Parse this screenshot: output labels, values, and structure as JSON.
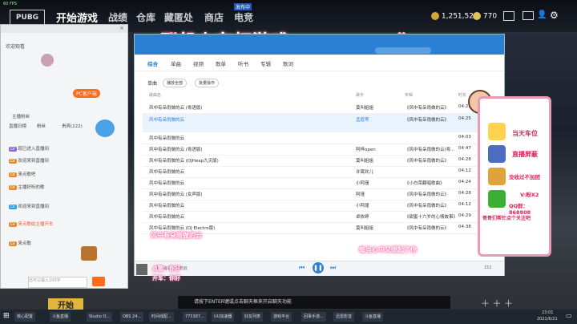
{
  "hud": {
    "fps": "60 FPS"
  },
  "game": {
    "logo": "PUBG",
    "tabs": [
      "开始游戏",
      "战绩",
      "仓库",
      "藏匿处",
      "商店",
      "电竞"
    ],
    "badge_live": "发布中",
    "currency": {
      "bp": "1,251,520",
      "g": "770"
    },
    "bottom_btn": "开始"
  },
  "left_panel": {
    "title": "欢迎观看",
    "pc_client_label": "PC客户端",
    "tabs": [
      "主播粉丝",
      "直播日榜",
      "粉丝",
      "贵宾(222)"
    ],
    "chat": [
      {
        "user": "贵宾",
        "text": "现已进入直播间"
      },
      {
        "user": "观众",
        "text": "欢迎来到直播间"
      },
      {
        "user": "观众",
        "text": "来点歌吧"
      },
      {
        "user": "观众",
        "text": "主播好听的歌"
      },
      {
        "user": "观众",
        "text": "欢迎来到直播间"
      },
      {
        "user": "观众",
        "text": "来点歌给主播开车"
      },
      {
        "user": "观众",
        "text": "来点歌"
      }
    ],
    "input_placeholder": "还可以输入100字"
  },
  "music": {
    "window_title": "飞机上车打游戏",
    "nav_tabs": [
      "综合",
      "单曲",
      "视频",
      "歌单",
      "听书",
      "专辑",
      "歌词"
    ],
    "section": "单曲",
    "buttons": [
      "播放全部",
      "批量操作"
    ],
    "col_headers": [
      "歌曲名",
      "歌手",
      "专辑",
      "时长"
    ],
    "songs": [
      {
        "name": "风中有朵雨做的云 (粤语版)",
        "artist": "莫叫姐姐",
        "album": "《风中有朵雨做的云》",
        "time": "04:23"
      },
      {
        "name": "风中有朵雨做的云",
        "artist": "孟庭苇",
        "album": "《风中有朵雨做的云》",
        "time": "04:25"
      },
      {
        "name": "风中有朵雨做的云",
        "artist": "",
        "album": "",
        "time": "04:03"
      },
      {
        "name": "风中有朵雨做的云 (粤语版)",
        "artist": "阿梓open",
        "album": "《风中有朵雨做的云(粤...",
        "time": "04:47"
      },
      {
        "name": "风中有朵雨做的云 (DJHeap九天版)",
        "artist": "莫叫姐姐",
        "album": "《风中有朵雨做的云》",
        "time": "04:28"
      },
      {
        "name": "风中有朵雨做的云",
        "artist": "许嵩欢儿",
        "album": "",
        "time": "04:12"
      },
      {
        "name": "风中有朵雨做的云",
        "artist": "小阿瑾",
        "album": "《小白菜翻唱歌曲》",
        "time": "04:24"
      },
      {
        "name": "风中有朵雨做的云 (女声版)",
        "artist": "阿瑾",
        "album": "《风中有朵雨做的云》",
        "time": "04:28"
      },
      {
        "name": "风中有朵雨做的云",
        "artist": "小阿瑾",
        "album": "《风中有朵雨做的云》",
        "time": "04:12"
      },
      {
        "name": "风中有朵雨做的云",
        "artist": "卓依婷",
        "album": "《甜蜜十六岁的心情故事》",
        "time": "04:29"
      },
      {
        "name": "风中有朵雨做的云 (DJ Electro版)",
        "artist": "莫叫姐姐",
        "album": "《风中有朵雨做的云》",
        "time": "04:38"
      }
    ],
    "lyric_left": "风中有朵雨做的云",
    "lyric_right": "每当心中又想起了你",
    "now_playing": "风中有朵雨做的云",
    "player_time": "152"
  },
  "overlay": {
    "lines": [
      "当天车位",
      "直播屏蔽",
      "没收过不加团",
      "V:粉X2",
      "QQ群：868808",
      "哥哥们帮忙点个关注吧"
    ]
  },
  "stream_sub": {
    "line1": "点歌：你好",
    "line2": "开车：你好"
  },
  "hint": "请按下ENTER键或点击聊天框来开启聊天功能",
  "taskbar": {
    "items": [
      "核心配置",
      "斗鱼直播",
      "Studio O...",
      "OBS 24...",
      "时间线配...",
      "775387...",
      "UU加速器",
      "好友列表",
      "游戏平台",
      "回事手游...",
      "迅雷影音",
      "斗鱼直播"
    ],
    "clock": "23:01",
    "date": "2021/6/21"
  }
}
